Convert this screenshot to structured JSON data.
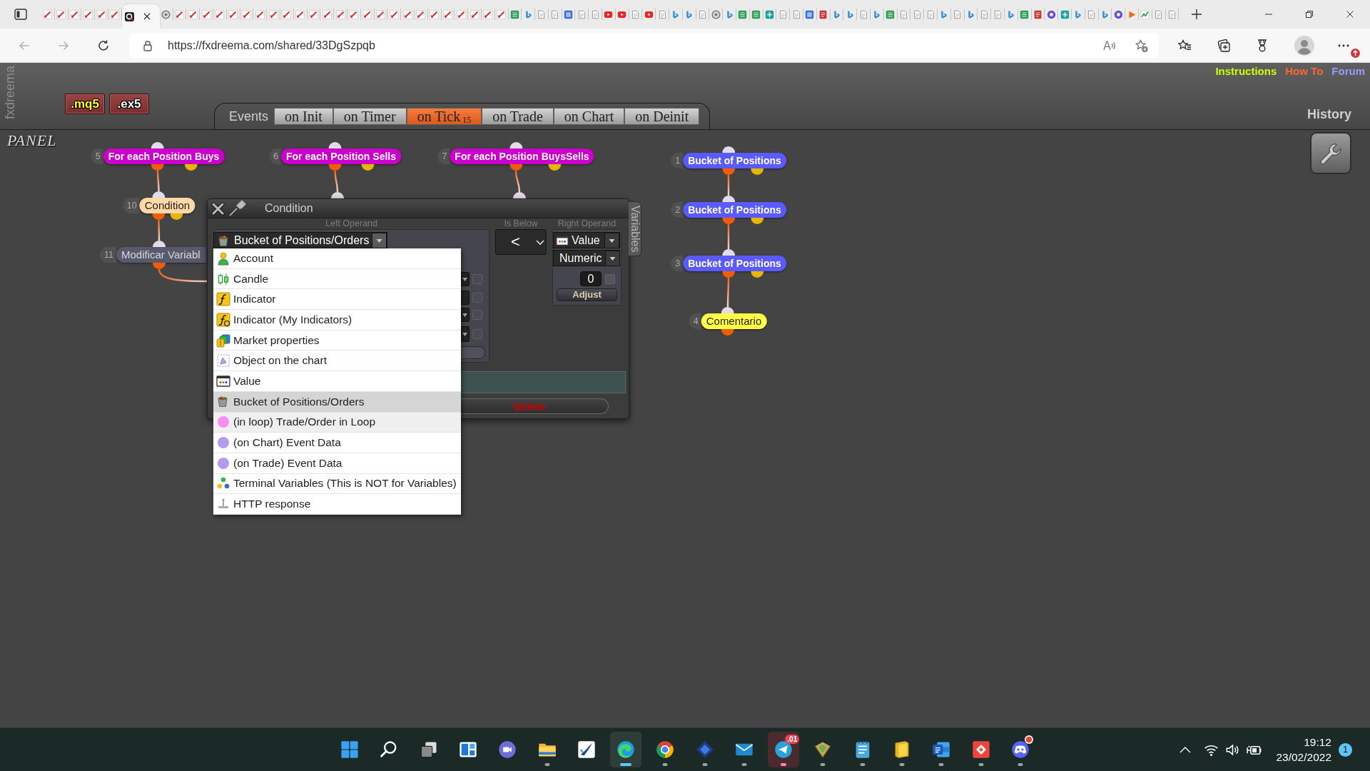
{
  "browser": {
    "tabs": [
      {
        "kind": "pencil",
        "selected": false
      },
      {
        "kind": "pencil",
        "selected": false
      },
      {
        "kind": "pencil",
        "selected": false
      },
      {
        "kind": "pencil",
        "selected": false
      },
      {
        "kind": "pencil",
        "selected": false
      },
      {
        "kind": "pencil",
        "selected": false
      },
      {
        "kind": "ring",
        "selected": true
      },
      {
        "kind": "circle",
        "selected": false
      },
      {
        "kind": "pencil",
        "selected": false
      },
      {
        "kind": "pencil",
        "selected": false
      },
      {
        "kind": "pencil",
        "selected": false
      },
      {
        "kind": "pencil",
        "selected": false
      },
      {
        "kind": "pencil",
        "selected": false
      },
      {
        "kind": "pencil",
        "selected": false
      },
      {
        "kind": "pencil",
        "selected": false
      },
      {
        "kind": "pencil",
        "selected": false
      },
      {
        "kind": "pencil",
        "selected": false
      },
      {
        "kind": "pencil",
        "selected": false
      },
      {
        "kind": "pencil",
        "selected": false
      },
      {
        "kind": "pencil",
        "selected": false
      },
      {
        "kind": "pencil",
        "selected": false
      },
      {
        "kind": "pencil",
        "selected": false
      },
      {
        "kind": "pencil",
        "selected": false
      },
      {
        "kind": "pencil",
        "selected": false
      },
      {
        "kind": "pencil",
        "selected": false
      },
      {
        "kind": "pencil",
        "selected": false
      },
      {
        "kind": "pencil",
        "selected": false
      },
      {
        "kind": "pencil",
        "selected": false
      },
      {
        "kind": "pencil",
        "selected": false
      },
      {
        "kind": "pencil",
        "selected": false
      },
      {
        "kind": "pencil",
        "selected": false
      },
      {
        "kind": "pencil",
        "selected": false
      },
      {
        "kind": "pencil",
        "selected": false
      },
      {
        "kind": "sheet",
        "selected": false
      },
      {
        "kind": "flag",
        "selected": false
      },
      {
        "kind": "page",
        "selected": false
      },
      {
        "kind": "page",
        "selected": false
      },
      {
        "kind": "tile",
        "selected": false
      },
      {
        "kind": "page",
        "selected": false
      },
      {
        "kind": "page",
        "selected": false
      },
      {
        "kind": "play",
        "selected": false
      },
      {
        "kind": "play",
        "selected": false
      },
      {
        "kind": "page",
        "selected": false
      },
      {
        "kind": "play",
        "selected": false
      },
      {
        "kind": "page",
        "selected": false
      },
      {
        "kind": "flag",
        "selected": false
      },
      {
        "kind": "flag",
        "selected": false
      },
      {
        "kind": "page",
        "selected": false
      },
      {
        "kind": "circle",
        "selected": false
      },
      {
        "kind": "flag",
        "selected": false
      },
      {
        "kind": "sheet",
        "selected": false
      },
      {
        "kind": "sheet",
        "selected": false
      },
      {
        "kind": "grid",
        "selected": false
      },
      {
        "kind": "page",
        "selected": false
      },
      {
        "kind": "page",
        "selected": false
      },
      {
        "kind": "tile",
        "selected": false
      },
      {
        "kind": "document",
        "selected": false
      },
      {
        "kind": "flag",
        "selected": false
      },
      {
        "kind": "flag",
        "selected": false
      },
      {
        "kind": "page",
        "selected": false
      },
      {
        "kind": "flag",
        "selected": false
      },
      {
        "kind": "sheet",
        "selected": false
      },
      {
        "kind": "page",
        "selected": false
      },
      {
        "kind": "page",
        "selected": false
      },
      {
        "kind": "page",
        "selected": false
      },
      {
        "kind": "flag",
        "selected": false
      },
      {
        "kind": "page",
        "selected": false
      },
      {
        "kind": "flag",
        "selected": false
      },
      {
        "kind": "page",
        "selected": false
      },
      {
        "kind": "page",
        "selected": false
      },
      {
        "kind": "flag",
        "selected": false
      },
      {
        "kind": "sheet",
        "selected": false
      },
      {
        "kind": "document",
        "selected": false
      },
      {
        "kind": "disc",
        "selected": false
      },
      {
        "kind": "grid",
        "selected": false
      },
      {
        "kind": "flag",
        "selected": false
      },
      {
        "kind": "page",
        "selected": false
      },
      {
        "kind": "flag",
        "selected": false
      },
      {
        "kind": "disc",
        "selected": false
      },
      {
        "kind": "triangle",
        "selected": false
      },
      {
        "kind": "chart",
        "selected": false
      },
      {
        "kind": "page",
        "selected": false
      },
      {
        "kind": "page",
        "selected": false
      }
    ],
    "back": {
      "disabled": true
    },
    "forward": {
      "disabled": true
    },
    "address": "https://fxdreema.com/shared/33DgSzpqb",
    "menu_alert": true
  },
  "header": {
    "brand": "fxdreema",
    "exports": [
      ".mq5",
      ".ex5"
    ],
    "events": {
      "label": "Events",
      "tabs": [
        {
          "label": "on Init",
          "selected": false
        },
        {
          "label": "on Timer",
          "selected": false
        },
        {
          "label": "on Tick$_{15}$",
          "selected": true
        },
        {
          "label": "on Trade",
          "selected": false
        },
        {
          "label": "on Chart",
          "selected": false
        },
        {
          "label": "on Deinit",
          "selected": false
        }
      ]
    },
    "links": [
      {
        "label": "Instructions",
        "color": "#ccff00"
      },
      {
        "label": "How To",
        "color": "#ff6633"
      },
      {
        "label": "Forum",
        "color": "#9999ff"
      }
    ],
    "history": "History"
  },
  "canvas": {
    "title": "PANEL",
    "nodes": [
      {
        "number": "5",
        "label": "For each Position Buys",
        "kind": "loop",
        "link_out": false,
        "children": [
          {
            "number": "10",
            "label": "Condition",
            "kind": "condition",
            "link_out": false,
            "children": [
              {
                "number": "11",
                "label": "Modificar Variabl",
                "kind": "action",
                "link_out": true
              }
            ]
          }
        ]
      },
      {
        "number": "6",
        "label": "For each Position Sells",
        "kind": "loop",
        "link_out": true
      },
      {
        "number": "7",
        "label": "For each Position BuysSells",
        "kind": "loop",
        "link_out": true
      },
      {
        "number": "1",
        "label": "Bucket of Positions",
        "kind": "bucket",
        "link_out": false,
        "children": [
          {
            "number": "2",
            "label": "Bucket of Positions",
            "kind": "bucket",
            "link_out": false,
            "children": [
              {
                "number": "3",
                "label": "Bucket of Positions",
                "kind": "bucket",
                "link_out": false,
                "children": [
                  {
                    "number": "4",
                    "label": "Comentario",
                    "kind": "comment",
                    "link_out": false
                  }
                ]
              }
            ]
          }
        ]
      }
    ]
  },
  "dialog": {
    "title": "Condition",
    "side_tab": "Variables",
    "left_operand": {
      "heading": "Left Operand",
      "value": "Bucket of Positions/Orders",
      "expanded": true,
      "fields": [
        {
          "kind": "dropdown",
          "checked": false
        },
        {
          "kind": "input",
          "checked": false
        },
        {
          "kind": "dropdown",
          "checked": false
        },
        {
          "kind": "dropdown",
          "checked": false
        }
      ],
      "options": [
        {
          "label": "Account",
          "selected": false,
          "highlighted": false
        },
        {
          "label": "Candle",
          "selected": false,
          "highlighted": false
        },
        {
          "label": "Indicator",
          "selected": false,
          "highlighted": false
        },
        {
          "label": "Indicator (My Indicators)",
          "selected": false,
          "highlighted": false
        },
        {
          "label": "Market properties",
          "selected": false,
          "highlighted": false
        },
        {
          "label": "Object on the chart",
          "selected": false,
          "highlighted": false
        },
        {
          "label": "Value",
          "selected": false,
          "highlighted": false
        },
        {
          "label": "Bucket of Positions/Orders",
          "selected": true,
          "highlighted": false
        },
        {
          "label": "(in loop) Trade/Order in Loop",
          "selected": false,
          "highlighted": true
        },
        {
          "label": "(on Chart) Event Data",
          "selected": false,
          "highlighted": false
        },
        {
          "label": "(on Trade) Event Data",
          "selected": false,
          "highlighted": false
        },
        {
          "label": "Terminal Variables (This is NOT for Variables)",
          "selected": false,
          "highlighted": false
        },
        {
          "label": "HTTP response",
          "selected": false,
          "highlighted": false
        }
      ]
    },
    "operator": {
      "heading": "Is Below",
      "value": "<"
    },
    "right_operand": {
      "heading": "Right Operand",
      "source": "Value",
      "type": "Numeric",
      "value": "0",
      "checked": false,
      "button": "Adjust"
    },
    "delete": "Delete"
  },
  "taskbar": {
    "apps": [
      {
        "running": false,
        "active": false,
        "attention": false,
        "notified": false
      },
      {
        "running": false,
        "active": false,
        "attention": false,
        "notified": false
      },
      {
        "running": false,
        "active": false,
        "attention": false,
        "notified": false
      },
      {
        "running": false,
        "active": false,
        "attention": false,
        "notified": false
      },
      {
        "running": false,
        "active": false,
        "attention": false,
        "notified": false
      },
      {
        "running": true,
        "active": false,
        "attention": false,
        "notified": false
      },
      {
        "running": false,
        "active": false,
        "attention": false,
        "notified": false
      },
      {
        "running": true,
        "active": true,
        "attention": false,
        "notified": false
      },
      {
        "running": true,
        "active": false,
        "attention": false,
        "notified": false
      },
      {
        "running": true,
        "active": false,
        "attention": false,
        "notified": false
      },
      {
        "running": true,
        "active": false,
        "attention": false,
        "notified": false
      },
      {
        "running": true,
        "active": false,
        "attention": true,
        "notified": false,
        "badge": ".01"
      },
      {
        "running": true,
        "active": false,
        "attention": false,
        "notified": false
      },
      {
        "running": true,
        "active": false,
        "attention": false,
        "notified": false
      },
      {
        "running": true,
        "active": false,
        "attention": false,
        "notified": false
      },
      {
        "running": true,
        "active": false,
        "attention": false,
        "notified": false
      },
      {
        "running": true,
        "active": false,
        "attention": false,
        "notified": false
      },
      {
        "running": true,
        "active": false,
        "attention": false,
        "notified": true
      }
    ],
    "tray": {
      "time": "19:12",
      "date": "23/02/2022",
      "notifications": "1"
    }
  }
}
